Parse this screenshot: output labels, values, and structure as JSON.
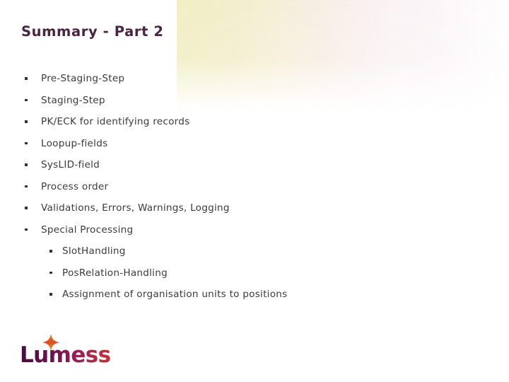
{
  "slide": {
    "title": "Summary - Part 2",
    "title_color": "#4A2440",
    "background_color": "#FFFFFF",
    "body_text_color": "#3B3B3B"
  },
  "bullets": [
    {
      "level": 1,
      "text": "Pre-Staging-Step"
    },
    {
      "level": 1,
      "text": "Staging-Step"
    },
    {
      "level": 1,
      "text": "PK/ECK for identifying records"
    },
    {
      "level": 1,
      "text": "Loopup-fields"
    },
    {
      "level": 1,
      "text": "SysLID-field"
    },
    {
      "level": 1,
      "text": "Process order"
    },
    {
      "level": 1,
      "text": "Validations, Errors, Warnings, Logging"
    },
    {
      "level": 1,
      "text": "Special Processing"
    },
    {
      "level": 2,
      "text": "SlotHandling"
    },
    {
      "level": 2,
      "text": "PosRelation-Handling"
    },
    {
      "level": 2,
      "text": "Assignment of organisation units to positions"
    }
  ],
  "logo": {
    "name": "lumesse-logo",
    "wordmark": "Lumesse",
    "gradient_start": "#4A0D3C",
    "gradient_mid": "#8E1A5A",
    "gradient_end": "#C9342B",
    "star_icon": "four-point-star-icon",
    "star_color_outer": "#E8821E",
    "star_color_inner": "#D93A2B"
  },
  "decoration": {
    "name": "star-grid-pattern",
    "motif": "four-point-star-icon",
    "grid_spacing_px": 24,
    "color_pink": "#F2D3DC",
    "color_yellow": "#F4F0CC",
    "color_mauve": "#E2D6E2"
  }
}
